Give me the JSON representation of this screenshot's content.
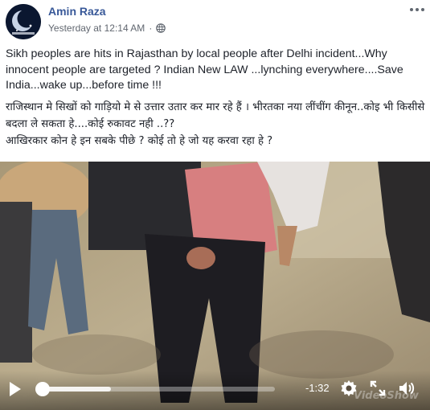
{
  "post": {
    "author_name": "Amin Raza",
    "timestamp": "Yesterday at 12:14 AM",
    "separator": "·",
    "privacy_icon": "globe-icon",
    "more_icon": "more-dots-icon",
    "text": {
      "english": "Sikh peoples are hits in Rajasthan by local people after Delhi incident...Why innocent people are targeted ? Indian New LAW ...lynching everywhere....Save India...wake up...before time !!!",
      "hindi_line_1": "राजिस्थान मे सिखों को गाड़ियो मे से उत्तार उतार कर मार रहे हैं । भीरतका नया लींचींग कीनून..कोइ भी किसीसे बदला ले सकता हे....कोई रुकावट नही ..??",
      "hindi_line_2": "आखिरकार कोन हे इन सबके पीछे ? कोई तो हे जो यह करवा रहा हे ?"
    }
  },
  "video": {
    "time_remaining": "-1:32",
    "progress_fraction": 0.3,
    "watermark": "VideoShow",
    "controls": {
      "play_icon": "play-icon",
      "settings_icon": "gear-icon",
      "fullscreen_icon": "fullscreen-icon",
      "volume_icon": "volume-icon"
    }
  },
  "colors": {
    "author_link": "#385898",
    "meta_text": "#616770",
    "body_text": "#1d2129"
  }
}
